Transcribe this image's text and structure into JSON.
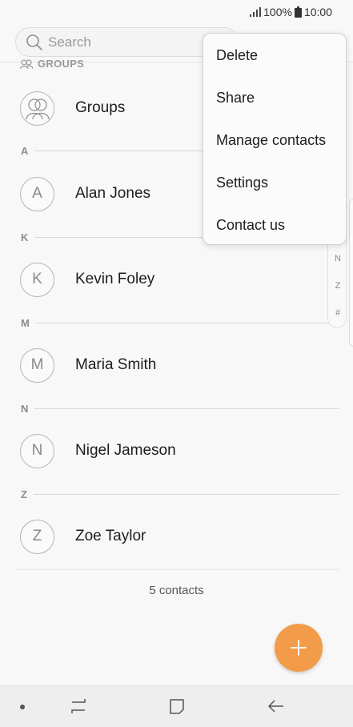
{
  "status_bar": {
    "battery": "100%",
    "time": "10:00"
  },
  "search": {
    "placeholder": "Search"
  },
  "groups_section": {
    "header": "GROUPS",
    "item_label": "Groups"
  },
  "sections": [
    {
      "letter": "A",
      "contact": {
        "initial": "A",
        "name": "Alan Jones"
      }
    },
    {
      "letter": "K",
      "contact": {
        "initial": "K",
        "name": "Kevin Foley"
      }
    },
    {
      "letter": "M",
      "contact": {
        "initial": "M",
        "name": "Maria Smith"
      }
    },
    {
      "letter": "N",
      "contact": {
        "initial": "N",
        "name": "Nigel Jameson"
      }
    },
    {
      "letter": "Z",
      "contact": {
        "initial": "Z",
        "name": "Zoe Taylor"
      }
    }
  ],
  "contacts_count": "5 contacts",
  "index_bar": [
    "N",
    "Z",
    "#"
  ],
  "menu": {
    "items": [
      "Delete",
      "Share",
      "Manage contacts",
      "Settings",
      "Contact us"
    ]
  },
  "fab": {
    "icon": "plus-icon",
    "color": "#f29c4a"
  },
  "nav_bar": {
    "icons": [
      "dot-icon",
      "recent-apps-icon",
      "home-icon",
      "back-icon"
    ]
  }
}
